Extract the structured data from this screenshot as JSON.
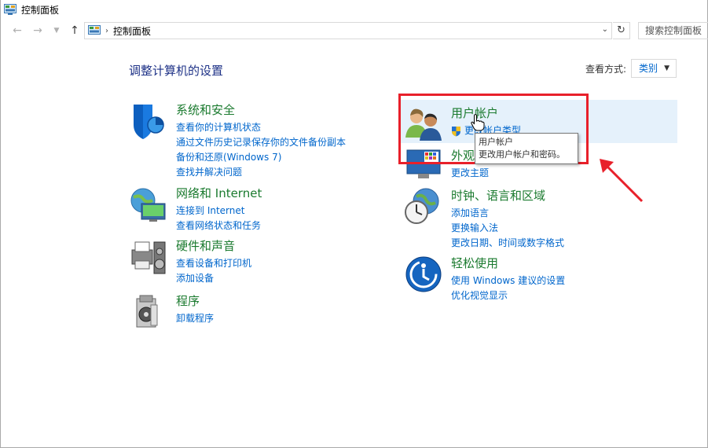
{
  "window": {
    "title": "控制面板"
  },
  "nav": {
    "back_icon": "arrow-left-icon",
    "forward_icon": "arrow-right-icon",
    "up_icon": "arrow-up-icon",
    "path": "控制面板",
    "search_placeholder": "搜索控制面板"
  },
  "main": {
    "heading": "调整计算机的设置",
    "view_by_label": "查看方式:",
    "view_by_value": "类别"
  },
  "categories": [
    {
      "title": "系统和安全",
      "icon": "shield-icon",
      "links": [
        "查看你的计算机状态",
        "通过文件历史记录保存你的文件备份副本",
        "备份和还原(Windows 7)",
        "查找并解决问题"
      ]
    },
    {
      "title": "网络和 Internet",
      "icon": "network-globe-icon",
      "links": [
        "连接到 Internet",
        "查看网络状态和任务"
      ]
    },
    {
      "title": "硬件和声音",
      "icon": "printer-speaker-icon",
      "links": [
        "查看设备和打印机",
        "添加设备"
      ]
    },
    {
      "title": "程序",
      "icon": "programs-disc-icon",
      "links": [
        "卸载程序"
      ]
    },
    {
      "title": "用户帐户",
      "icon": "users-icon",
      "links": [
        "更改帐户类型"
      ]
    },
    {
      "title": "外观",
      "icon": "appearance-monitor-icon",
      "links": [
        "更改主题"
      ]
    },
    {
      "title": "时钟、语言和区域",
      "icon": "clock-globe-icon",
      "links": [
        "添加语言",
        "更换输入法",
        "更改日期、时间或数字格式"
      ]
    },
    {
      "title": "轻松使用",
      "icon": "accessibility-icon",
      "links": [
        "使用 Windows 建议的设置",
        "优化视觉显示"
      ]
    }
  ],
  "tooltip": {
    "line1": "用户帐户",
    "line2": "更改用户帐户和密码。"
  },
  "colors": {
    "link": "#0066cc",
    "category_title": "#1a7a2e",
    "heading": "#1e3287",
    "highlight_box": "#e8202a",
    "hover_bg": "#e5f1fb"
  }
}
